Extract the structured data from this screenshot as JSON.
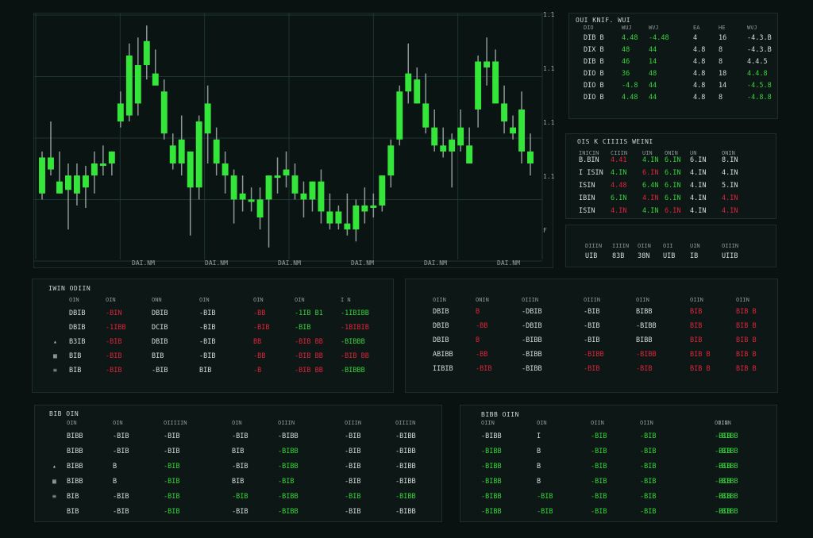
{
  "chart": {
    "x_ticks": [
      "DAI.NM",
      "DAI.NM",
      "DAI.NM",
      "DAI.NM",
      "DAI.NM",
      "DAI.NM"
    ],
    "y_ticks": [
      "1.1",
      "1.1",
      "1.1",
      "1.1",
      "F"
    ],
    "colors": {
      "up": "#34e53a",
      "wick": "#8e9896",
      "grid": "#1f3532"
    }
  },
  "chart_data": {
    "type": "candlestick",
    "candles": [
      {
        "o": 155,
        "h": 160,
        "l": 120,
        "c": 125,
        "up": true
      },
      {
        "o": 155,
        "h": 185,
        "l": 140,
        "c": 145,
        "up": false
      },
      {
        "o": 135,
        "h": 160,
        "l": 125,
        "c": 125,
        "up": false
      },
      {
        "o": 128,
        "h": 150,
        "l": 95,
        "c": 140,
        "up": true
      },
      {
        "o": 140,
        "h": 150,
        "l": 115,
        "c": 125,
        "up": false
      },
      {
        "o": 130,
        "h": 148,
        "l": 113,
        "c": 140,
        "up": true
      },
      {
        "o": 140,
        "h": 160,
        "l": 125,
        "c": 150,
        "up": true
      },
      {
        "o": 150,
        "h": 165,
        "l": 140,
        "c": 150,
        "up": false
      },
      {
        "o": 150,
        "h": 160,
        "l": 140,
        "c": 160,
        "up": true
      },
      {
        "o": 185,
        "h": 210,
        "l": 180,
        "c": 200,
        "up": true
      },
      {
        "o": 190,
        "h": 250,
        "l": 185,
        "c": 240,
        "up": true
      },
      {
        "o": 200,
        "h": 255,
        "l": 190,
        "c": 232,
        "up": true
      },
      {
        "o": 232,
        "h": 265,
        "l": 220,
        "c": 252,
        "up": true
      },
      {
        "o": 225,
        "h": 245,
        "l": 215,
        "c": 215,
        "up": false
      },
      {
        "o": 210,
        "h": 220,
        "l": 170,
        "c": 175,
        "up": false
      },
      {
        "o": 150,
        "h": 175,
        "l": 145,
        "c": 165,
        "up": true
      },
      {
        "o": 170,
        "h": 190,
        "l": 140,
        "c": 150,
        "up": false
      },
      {
        "o": 160,
        "h": 155,
        "l": 90,
        "c": 130,
        "up": false
      },
      {
        "o": 130,
        "h": 190,
        "l": 120,
        "c": 185,
        "up": true
      },
      {
        "o": 175,
        "h": 215,
        "l": 150,
        "c": 200,
        "up": true
      },
      {
        "o": 170,
        "h": 180,
        "l": 140,
        "c": 150,
        "up": false
      },
      {
        "o": 150,
        "h": 160,
        "l": 125,
        "c": 140,
        "up": false
      },
      {
        "o": 140,
        "h": 145,
        "l": 100,
        "c": 120,
        "up": false
      },
      {
        "o": 125,
        "h": 140,
        "l": 110,
        "c": 120,
        "up": false
      },
      {
        "o": 120,
        "h": 130,
        "l": 110,
        "c": 120,
        "up": false
      },
      {
        "o": 120,
        "h": 130,
        "l": 95,
        "c": 105,
        "up": false
      },
      {
        "o": 120,
        "h": 135,
        "l": 80,
        "c": 140,
        "up": true
      },
      {
        "o": 140,
        "h": 155,
        "l": 125,
        "c": 140,
        "up": false
      },
      {
        "o": 140,
        "h": 160,
        "l": 130,
        "c": 145,
        "up": true
      },
      {
        "o": 140,
        "h": 150,
        "l": 120,
        "c": 125,
        "up": false
      },
      {
        "o": 120,
        "h": 135,
        "l": 105,
        "c": 125,
        "up": true
      },
      {
        "o": 120,
        "h": 135,
        "l": 110,
        "c": 135,
        "up": true
      },
      {
        "o": 135,
        "h": 145,
        "l": 100,
        "c": 110,
        "up": false
      },
      {
        "o": 110,
        "h": 125,
        "l": 95,
        "c": 100,
        "up": false
      },
      {
        "o": 100,
        "h": 115,
        "l": 95,
        "c": 110,
        "up": false
      },
      {
        "o": 100,
        "h": 125,
        "l": 90,
        "c": 95,
        "up": false
      },
      {
        "o": 95,
        "h": 120,
        "l": 85,
        "c": 115,
        "up": true
      },
      {
        "o": 115,
        "h": 130,
        "l": 100,
        "c": 110,
        "up": false
      },
      {
        "o": 115,
        "h": 125,
        "l": 105,
        "c": 115,
        "up": false
      },
      {
        "o": 115,
        "h": 140,
        "l": 110,
        "c": 140,
        "up": true
      },
      {
        "o": 140,
        "h": 170,
        "l": 130,
        "c": 165,
        "up": true
      },
      {
        "o": 170,
        "h": 215,
        "l": 165,
        "c": 210,
        "up": true
      },
      {
        "o": 210,
        "h": 250,
        "l": 200,
        "c": 225,
        "up": false
      },
      {
        "o": 220,
        "h": 230,
        "l": 200,
        "c": 200,
        "up": false
      },
      {
        "o": 200,
        "h": 225,
        "l": 175,
        "c": 180,
        "up": false
      },
      {
        "o": 180,
        "h": 195,
        "l": 160,
        "c": 165,
        "up": false
      },
      {
        "o": 165,
        "h": 180,
        "l": 155,
        "c": 160,
        "up": false
      },
      {
        "o": 160,
        "h": 175,
        "l": 130,
        "c": 170,
        "up": true
      },
      {
        "o": 180,
        "h": 195,
        "l": 160,
        "c": 165,
        "up": false
      },
      {
        "o": 165,
        "h": 180,
        "l": 150,
        "c": 150,
        "up": false
      },
      {
        "o": 195,
        "h": 240,
        "l": 180,
        "c": 235,
        "up": true
      },
      {
        "o": 230,
        "h": 255,
        "l": 215,
        "c": 235,
        "up": false
      },
      {
        "o": 235,
        "h": 245,
        "l": 200,
        "c": 200,
        "up": false
      },
      {
        "o": 200,
        "h": 215,
        "l": 175,
        "c": 185,
        "up": true
      },
      {
        "o": 180,
        "h": 190,
        "l": 170,
        "c": 175,
        "up": false
      },
      {
        "o": 195,
        "h": 210,
        "l": 150,
        "c": 160,
        "up": true
      },
      {
        "o": 160,
        "h": 175,
        "l": 140,
        "c": 150,
        "up": false
      }
    ],
    "ylim": [
      70,
      275
    ]
  },
  "panel_tr1": {
    "title": "OUI KNIF. WUI",
    "headers": [
      "DIO",
      "WUJ",
      "WVJ",
      "EA",
      "HE",
      "WVJ"
    ],
    "rows": [
      [
        "DIB B",
        "4.48",
        "-4.48",
        "4",
        "16",
        "-4.3.B"
      ],
      [
        "DIX B",
        "48",
        "44",
        "4.8",
        "8",
        "-4.3.B"
      ],
      [
        "DIB B",
        "46",
        "14",
        "4.8",
        "8",
        "4.4.5"
      ],
      [
        "DIO B",
        "36",
        "48",
        "4.8",
        "18",
        "4.4.8"
      ],
      [
        "DIO B",
        "-4.8",
        "44",
        "4.8",
        "14",
        "-4.5.8"
      ],
      [
        "DIO B",
        "4.48",
        "44",
        "4.8",
        "8",
        "-4.8.8"
      ]
    ]
  },
  "panel_tr2": {
    "title": "OIS K CIIIIS WEINI",
    "headers": [
      "INICIN",
      "CIIIN",
      "UIN",
      "ONIN",
      "UN",
      "ONIN"
    ],
    "rows": [
      [
        "B.BIN",
        "4.41",
        "4.IN",
        "6.IN",
        "6.IN",
        "8.IN"
      ],
      [
        "I ISIN",
        "4.IN",
        "6.IN",
        "6.IN",
        "4.IN",
        "4.IN"
      ],
      [
        "ISIN",
        "4.48",
        "6.4N",
        "6.IN",
        "4.IN",
        "5.IN"
      ],
      [
        "IBIN",
        "6.IN",
        "4.IN",
        "6.IN",
        "4.IN",
        "4.IN"
      ],
      [
        "ISIN",
        "4.IN",
        "4.IN",
        "6.IN",
        "4.IN",
        "4.IN"
      ]
    ]
  },
  "panel_tr3": {
    "headers": [
      "DIIIN",
      "IIIIN",
      "OIIN",
      "OII",
      "UIN",
      "OIIIN"
    ],
    "values": [
      "UIB",
      "83B",
      "38N",
      "UIB",
      "IB",
      "UIIB"
    ]
  },
  "panel_ml": {
    "title": "IWIN ODIIN",
    "headers": [
      "OIN",
      "OIN",
      "ONN",
      "OIN",
      "OIN",
      "OIN",
      "I N"
    ],
    "rows": [
      [
        "DBIB",
        "-BIN",
        "DBIB",
        "-BIB",
        "-BB",
        "-1IB B1",
        "-1IBIBB"
      ],
      [
        "DBIB",
        "-1IBB",
        "DCIB",
        "-BIB",
        "-BIB",
        "-BIB",
        "-1BIBIB"
      ],
      [
        "B3IB",
        "-BIB",
        "DBIB",
        "-BIB",
        "BB",
        "-BIB BB",
        "-BIBBB"
      ],
      [
        "BIB",
        "-BIB",
        "BIB",
        "-BIB",
        "-BB",
        "-BIB BB",
        "-BIB BB"
      ],
      [
        "BIB",
        "-BIB",
        "-BIB",
        "BIB",
        "-B",
        "-BIB BB",
        "-BIBBB"
      ]
    ]
  },
  "panel_mr": {
    "headers": [
      "OIIN",
      "ONIN",
      "OIIIN",
      "OIIIN",
      "OIIN",
      "OIIN",
      "OIIN"
    ],
    "rows": [
      [
        "DBIB",
        "B",
        "-DBIB",
        "-BIB",
        "BIBB",
        "BIB",
        "BIB B"
      ],
      [
        "DBIB",
        "-BB",
        "-DBIB",
        "-BIB",
        "-BIBB",
        "BIB",
        "BIB B"
      ],
      [
        "DBIB",
        "B",
        "-BIBB",
        "-BIB",
        "BIBB",
        "BIB",
        "BIB B"
      ],
      [
        "ABIBB",
        "-BB",
        "-BIBB",
        "-BIBB",
        "-BIBB",
        "BIB B",
        "BIB B"
      ],
      [
        "IIBIB",
        "-BIB",
        "-BIBB",
        "-BIB",
        "-BIB",
        "BIB B",
        "BIB B"
      ]
    ]
  },
  "panel_bl": {
    "title": "BIB OIN",
    "headers": [
      "OIN",
      "OIN",
      "OIIIIIN",
      "OIN",
      "OIIIN",
      "OIIIN",
      "OIIIIN"
    ],
    "rows": [
      [
        "BIBB",
        "-BIB",
        "-BIB",
        "-BIB",
        "-BIBB",
        "-BIB",
        "-BIBB"
      ],
      [
        "BIBB",
        "-BIB",
        "-BIB",
        "BIB",
        "-BIBB",
        "-BIB",
        "-BIBB"
      ],
      [
        "BIBB",
        "B",
        "-BIB",
        "-BIB",
        "-BIBB",
        "-BIB",
        "-BIBB"
      ],
      [
        "BIBB",
        "B",
        "-BIB",
        "BIB",
        "-BIB",
        "-BIB",
        "-BIBB"
      ],
      [
        "BIB",
        "-BIB",
        "-BIB",
        "-BIB",
        "-BIBB",
        "-BIB",
        "-BIBB"
      ],
      [
        "BIB",
        "-BIB",
        "-BIB",
        "-BIB",
        "-BIBB",
        "-BIB",
        "-BIBB"
      ]
    ]
  },
  "panel_br": {
    "title": "BIBB OIIN",
    "headers": [
      "OIIN",
      "OIN",
      "OIIN",
      "OIIN",
      "OIIN",
      "OIIN"
    ],
    "rows": [
      [
        "-BIBB",
        "I",
        "-BIB",
        "-BIB",
        "-BIB",
        "-BIBB"
      ],
      [
        "-BIBB",
        "B",
        "-BIB",
        "-BIB",
        "-BIB",
        "-BIBB"
      ],
      [
        "-BIBB",
        "B",
        "-BIB",
        "-BIB",
        "-BIB",
        "-BIBB"
      ],
      [
        "-BIBB",
        "B",
        "-BIB",
        "-BIB",
        "-BIB",
        "-BIBB"
      ],
      [
        "-BIBB",
        "-BIB",
        "-BIB",
        "-BIB",
        "-BIB",
        "-BIBB"
      ],
      [
        "-BIBB",
        "-BIB",
        "-BIB",
        "-BIB",
        "-BIB",
        "-BIBB"
      ]
    ]
  }
}
